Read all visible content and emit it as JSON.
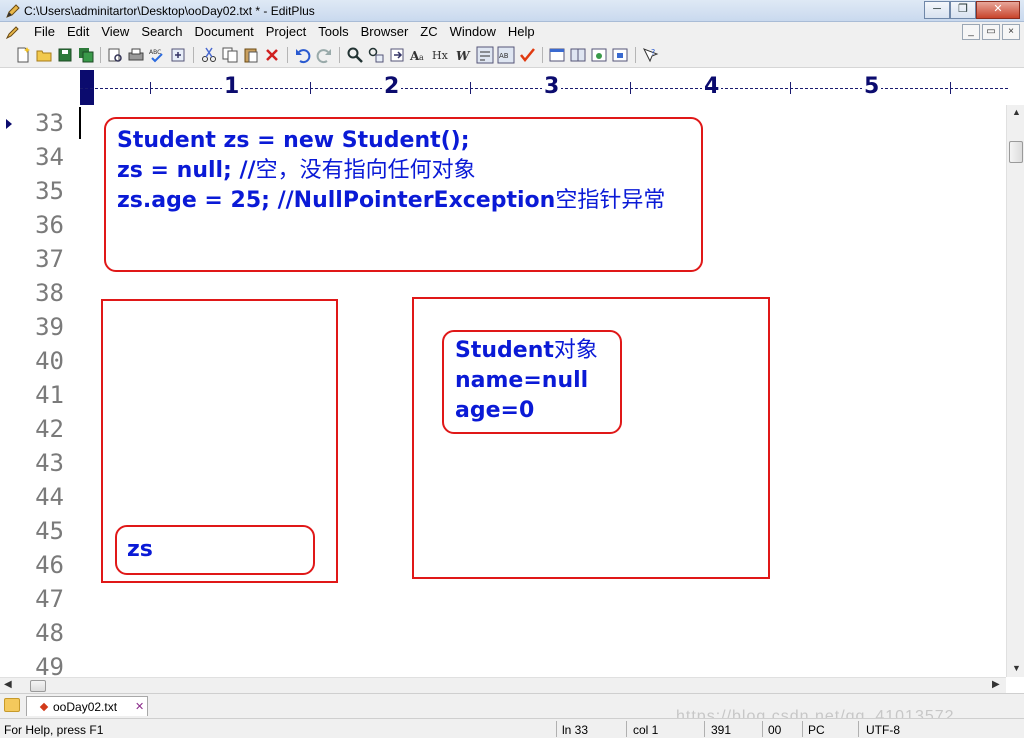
{
  "window": {
    "title": "C:\\Users\\adminitartor\\Desktop\\ooDay02.txt * - EditPlus",
    "minimize_glyph": "─",
    "restore_glyph": "❐",
    "close_glyph": "✕"
  },
  "menubar": {
    "items": [
      "File",
      "Edit",
      "View",
      "Search",
      "Document",
      "Project",
      "Tools",
      "Browser",
      "ZC",
      "Window",
      "Help"
    ],
    "mdi_minimize": "_",
    "mdi_restore": "▭",
    "mdi_close": "×"
  },
  "toolbar": {
    "icons": [
      "new-file-icon",
      "open-folder-icon",
      "save-icon",
      "save-all-icon",
      "print-preview-icon",
      "print-icon",
      "spell-check-icon",
      "abc-icon",
      "refresh-icon",
      "cut-icon",
      "copy-icon",
      "paste-icon",
      "delete-icon",
      "undo-icon",
      "redo-icon",
      "find-icon",
      "replace-icon",
      "font-icon",
      "hex-icon",
      "word-wrap-icon",
      "ruler-icon",
      "line-number-icon",
      "check-icon",
      "window-icon",
      "split-icon",
      "browser-icon",
      "fullscreen-icon",
      "help-icon"
    ]
  },
  "ruler": {
    "numbers": [
      "1",
      "2",
      "3",
      "4",
      "5"
    ]
  },
  "editor": {
    "line_numbers": [
      "33",
      "34",
      "35",
      "36",
      "37",
      "38",
      "39",
      "40",
      "41",
      "42",
      "43",
      "44",
      "45",
      "46",
      "47",
      "48",
      "49"
    ],
    "current_line": "33",
    "code_box": {
      "line1": "Student zs = new Student();",
      "line2_code": "zs = null; //",
      "line2_comment": "空，没有指向任何对象",
      "line3_code": "zs.age = 25; //NullPointerException",
      "line3_comment": "空指针异常"
    },
    "stack_var": "zs",
    "object_box": {
      "line1_code": "Student",
      "line1_comment": "对象",
      "line2": "name=null",
      "line3": "age=0"
    },
    "text_color": "#0a1ad6",
    "box_color": "#e01818"
  },
  "tabs": {
    "active": "ooDay02.txt",
    "close_glyph": "✕"
  },
  "statusbar": {
    "help": "For Help, press F1",
    "line": "ln 33",
    "col": "col 1",
    "chars": "391",
    "code": "00",
    "mode": "PC",
    "encoding": "UTF-8"
  },
  "watermark": "https://blog.csdn.net/qq_41013572"
}
